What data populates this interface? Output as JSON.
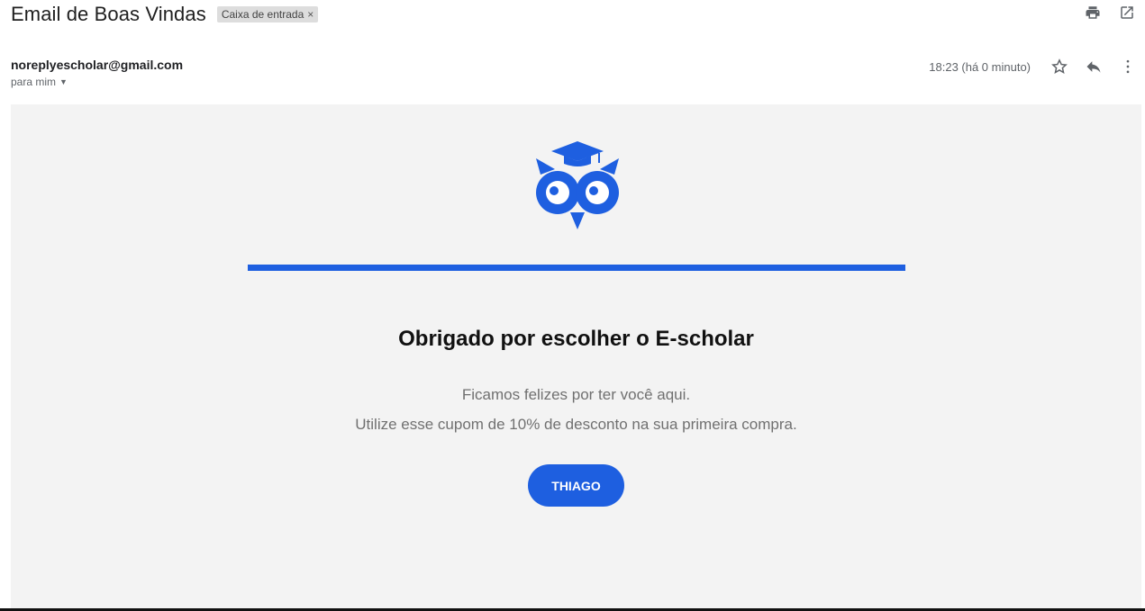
{
  "header": {
    "subject": "Email de Boas Vindas",
    "label": "Caixa de entrada",
    "label_close": "×",
    "actions": [
      "print-icon",
      "open-in-new-window-icon"
    ]
  },
  "message": {
    "sender": "noreplyescholar@gmail.com",
    "recipient": "para mim",
    "time": "18:23 (há 0 minuto)",
    "actions": [
      "star-icon",
      "reply-icon",
      "more-options-icon"
    ]
  },
  "body": {
    "headline": "Obrigado por escolher o E-scholar",
    "line1": "Ficamos felizes por ter você aqui.",
    "line2": "Utilize esse cupom de 10% de desconto na sua primeira compra.",
    "coupon_button": "THIAGO",
    "brand_color": "#1e5fe0",
    "logo": "owl-with-graduation-cap-logo"
  }
}
